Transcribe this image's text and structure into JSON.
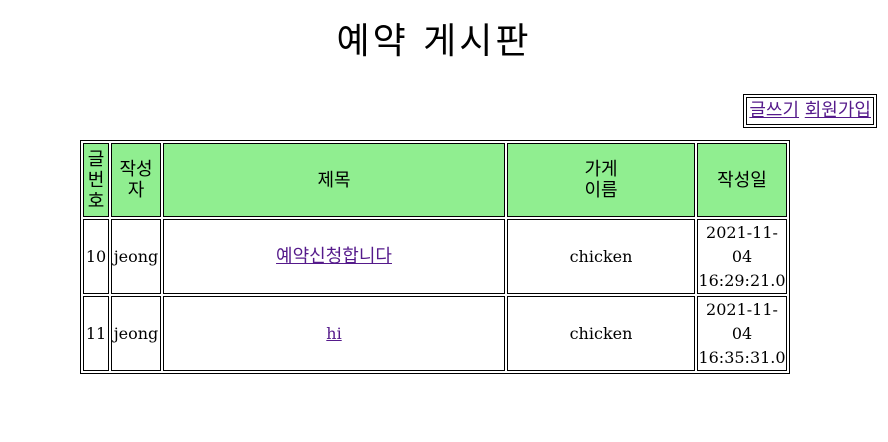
{
  "page": {
    "title": "예약 게시판"
  },
  "actions": {
    "write_label": "글쓰기",
    "signup_label": "회원가입"
  },
  "table": {
    "headers": {
      "no": [
        "글",
        "번",
        "호"
      ],
      "author": [
        "작성",
        "자"
      ],
      "subject": "제목",
      "store": [
        "가게",
        "이름"
      ],
      "date": "작성일"
    },
    "rows": [
      {
        "no": "10",
        "author": "jeong",
        "subject": "예약신청합니다",
        "store": "chicken",
        "date": [
          "2021-11-",
          "04",
          "16:29:21.0"
        ]
      },
      {
        "no": "11",
        "author": "jeong",
        "subject": "hi",
        "store": "chicken",
        "date": [
          "2021-11-",
          "04",
          "16:35:31.0"
        ]
      }
    ]
  },
  "colors": {
    "header_bg": "#90ee90",
    "link": "#551a8b"
  }
}
